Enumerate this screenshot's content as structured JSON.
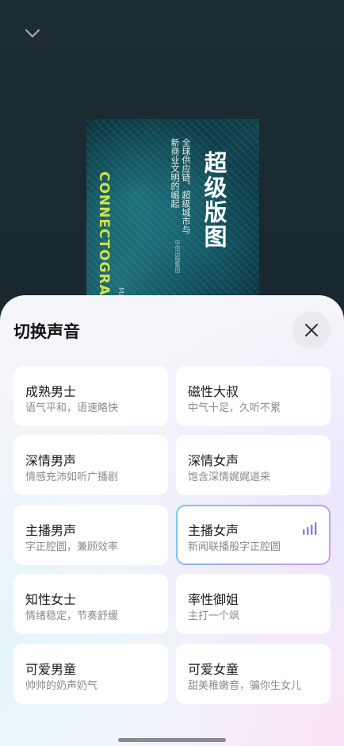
{
  "book": {
    "title_cn": "超级版图",
    "subtitle_cn": "全球供应链、超级城市与\n新商业文明的崛起",
    "title_en": "CONNECTOGRAPHY",
    "subtitle_en": "Mapping the Future of Global Civilization",
    "publisher": "中信出版集团"
  },
  "sheet": {
    "title": "切换声音"
  },
  "voices": [
    {
      "name": "成熟男士",
      "desc": "语气平和，语速略快",
      "selected": false
    },
    {
      "name": "磁性大叔",
      "desc": "中气十足，久听不累",
      "selected": false
    },
    {
      "name": "深情男声",
      "desc": "情感充沛如听广播剧",
      "selected": false
    },
    {
      "name": "深情女声",
      "desc": "饱含深情娓娓道来",
      "selected": false
    },
    {
      "name": "主播男声",
      "desc": "字正腔圆，兼顾效率",
      "selected": false
    },
    {
      "name": "主播女声",
      "desc": "新闻联播般字正腔圆",
      "selected": true
    },
    {
      "name": "知性女士",
      "desc": "情绪稳定，节奏舒缓",
      "selected": false
    },
    {
      "name": "率性御姐",
      "desc": "主打一个飒",
      "selected": false
    },
    {
      "name": "可爱男童",
      "desc": "帅帅的奶声奶气",
      "selected": false
    },
    {
      "name": "可爱女童",
      "desc": "甜美稚嫩音，骗你生女儿",
      "selected": false
    }
  ],
  "icons": {
    "collapse": "chevron-down-icon",
    "close": "close-icon",
    "playing": "equalizer-icon"
  },
  "colors": {
    "sheet_background": "#f6f5fa",
    "accent_gradient_start": "#6fcfe3",
    "accent_gradient_end": "#d59bf0",
    "equalizer": "#8f7be8"
  }
}
